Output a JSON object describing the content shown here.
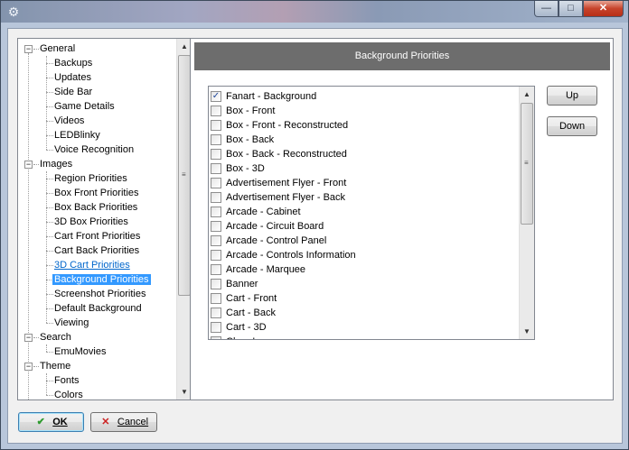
{
  "window": {
    "title": "",
    "controls": {
      "minimize": "—",
      "maximize": "□",
      "close": "✕"
    }
  },
  "tree": {
    "groups": [
      {
        "label": "General",
        "children": [
          "Backups",
          "Updates",
          "Side Bar",
          "Game Details",
          "Videos",
          "LEDBlinky",
          "Voice Recognition"
        ]
      },
      {
        "label": "Images",
        "children": [
          "Region Priorities",
          "Box Front Priorities",
          "Box Back Priorities",
          "3D Box Priorities",
          "Cart Front Priorities",
          "Cart Back Priorities",
          "3D Cart Priorities",
          "Background Priorities",
          "Screenshot Priorities",
          "Default Background",
          "Viewing"
        ]
      },
      {
        "label": "Search",
        "children": [
          "EmuMovies"
        ]
      },
      {
        "label": "Theme",
        "children": [
          "Fonts",
          "Colors"
        ]
      }
    ],
    "selected": "Background Priorities",
    "hovered": "3D Cart Priorities",
    "expander_symbol": "−"
  },
  "panel": {
    "title": "Background Priorities",
    "items": [
      {
        "label": "Fanart - Background",
        "checked": true
      },
      {
        "label": "Box - Front",
        "checked": false
      },
      {
        "label": "Box - Front - Reconstructed",
        "checked": false
      },
      {
        "label": "Box - Back",
        "checked": false
      },
      {
        "label": "Box - Back - Reconstructed",
        "checked": false
      },
      {
        "label": "Box - 3D",
        "checked": false
      },
      {
        "label": "Advertisement Flyer - Front",
        "checked": false
      },
      {
        "label": "Advertisement Flyer - Back",
        "checked": false
      },
      {
        "label": "Arcade - Cabinet",
        "checked": false
      },
      {
        "label": "Arcade - Circuit Board",
        "checked": false
      },
      {
        "label": "Arcade - Control Panel",
        "checked": false
      },
      {
        "label": "Arcade - Controls Information",
        "checked": false
      },
      {
        "label": "Arcade - Marquee",
        "checked": false
      },
      {
        "label": "Banner",
        "checked": false
      },
      {
        "label": "Cart - Front",
        "checked": false
      },
      {
        "label": "Cart - Back",
        "checked": false
      },
      {
        "label": "Cart - 3D",
        "checked": false
      },
      {
        "label": "Clear Logo",
        "checked": false
      }
    ],
    "up_label": "Up",
    "down_label": "Down",
    "checkmark": "✓"
  },
  "footer": {
    "ok_label": "OK",
    "ok_icon": "✔",
    "cancel_label": "Cancel",
    "cancel_icon": "✕",
    "ok_icon_color": "#2e9a2e",
    "cancel_icon_color": "#cc2222"
  }
}
